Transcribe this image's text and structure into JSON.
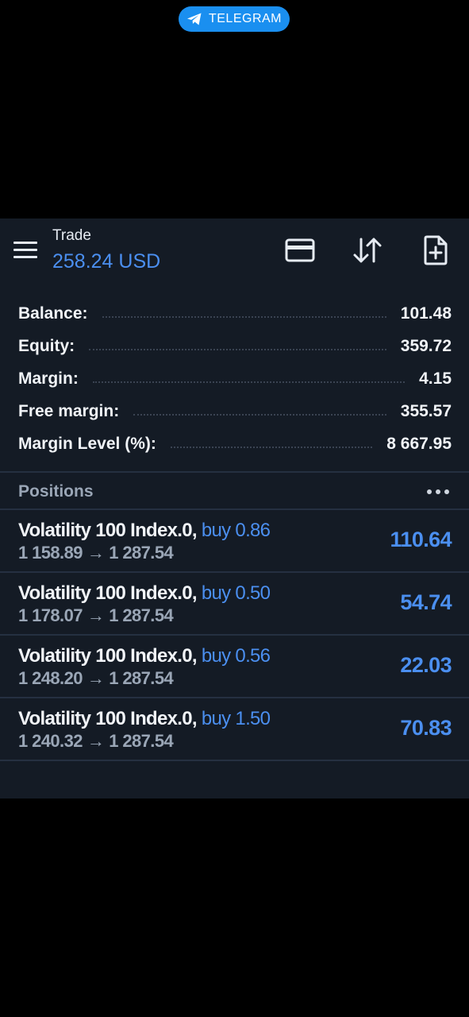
{
  "overlay": {
    "telegram_label": "TELEGRAM"
  },
  "header": {
    "title": "Trade",
    "balance": "258.24 USD",
    "icons": [
      "menu-icon",
      "card-icon",
      "sort-arrows-icon",
      "add-document-icon"
    ]
  },
  "summary": {
    "rows": [
      {
        "label": "Balance:",
        "value": "101.48"
      },
      {
        "label": "Equity:",
        "value": "359.72"
      },
      {
        "label": "Margin:",
        "value": "4.15"
      },
      {
        "label": "Free margin:",
        "value": "355.57"
      },
      {
        "label": "Margin Level (%):",
        "value": "8 667.95"
      }
    ]
  },
  "positions": {
    "title": "Positions",
    "items": [
      {
        "symbol": "Volatility 100 Index.0,",
        "side": "buy 0.86",
        "open": "1 158.89",
        "arrow": "→",
        "current": "1 287.54",
        "profit": "110.64"
      },
      {
        "symbol": "Volatility 100 Index.0,",
        "side": "buy 0.50",
        "open": "1 178.07",
        "arrow": "→",
        "current": "1 287.54",
        "profit": "54.74"
      },
      {
        "symbol": "Volatility 100 Index.0,",
        "side": "buy 0.56",
        "open": "1 248.20",
        "arrow": "→",
        "current": "1 287.54",
        "profit": "22.03"
      },
      {
        "symbol": "Volatility 100 Index.0,",
        "side": "buy 1.50",
        "open": "1 240.32",
        "arrow": "→",
        "current": "1 287.54",
        "profit": "70.83"
      }
    ]
  },
  "colors": {
    "accent": "#4b8ff0",
    "panel_bg": "#141b25",
    "telegram": "#1a8ff0"
  }
}
